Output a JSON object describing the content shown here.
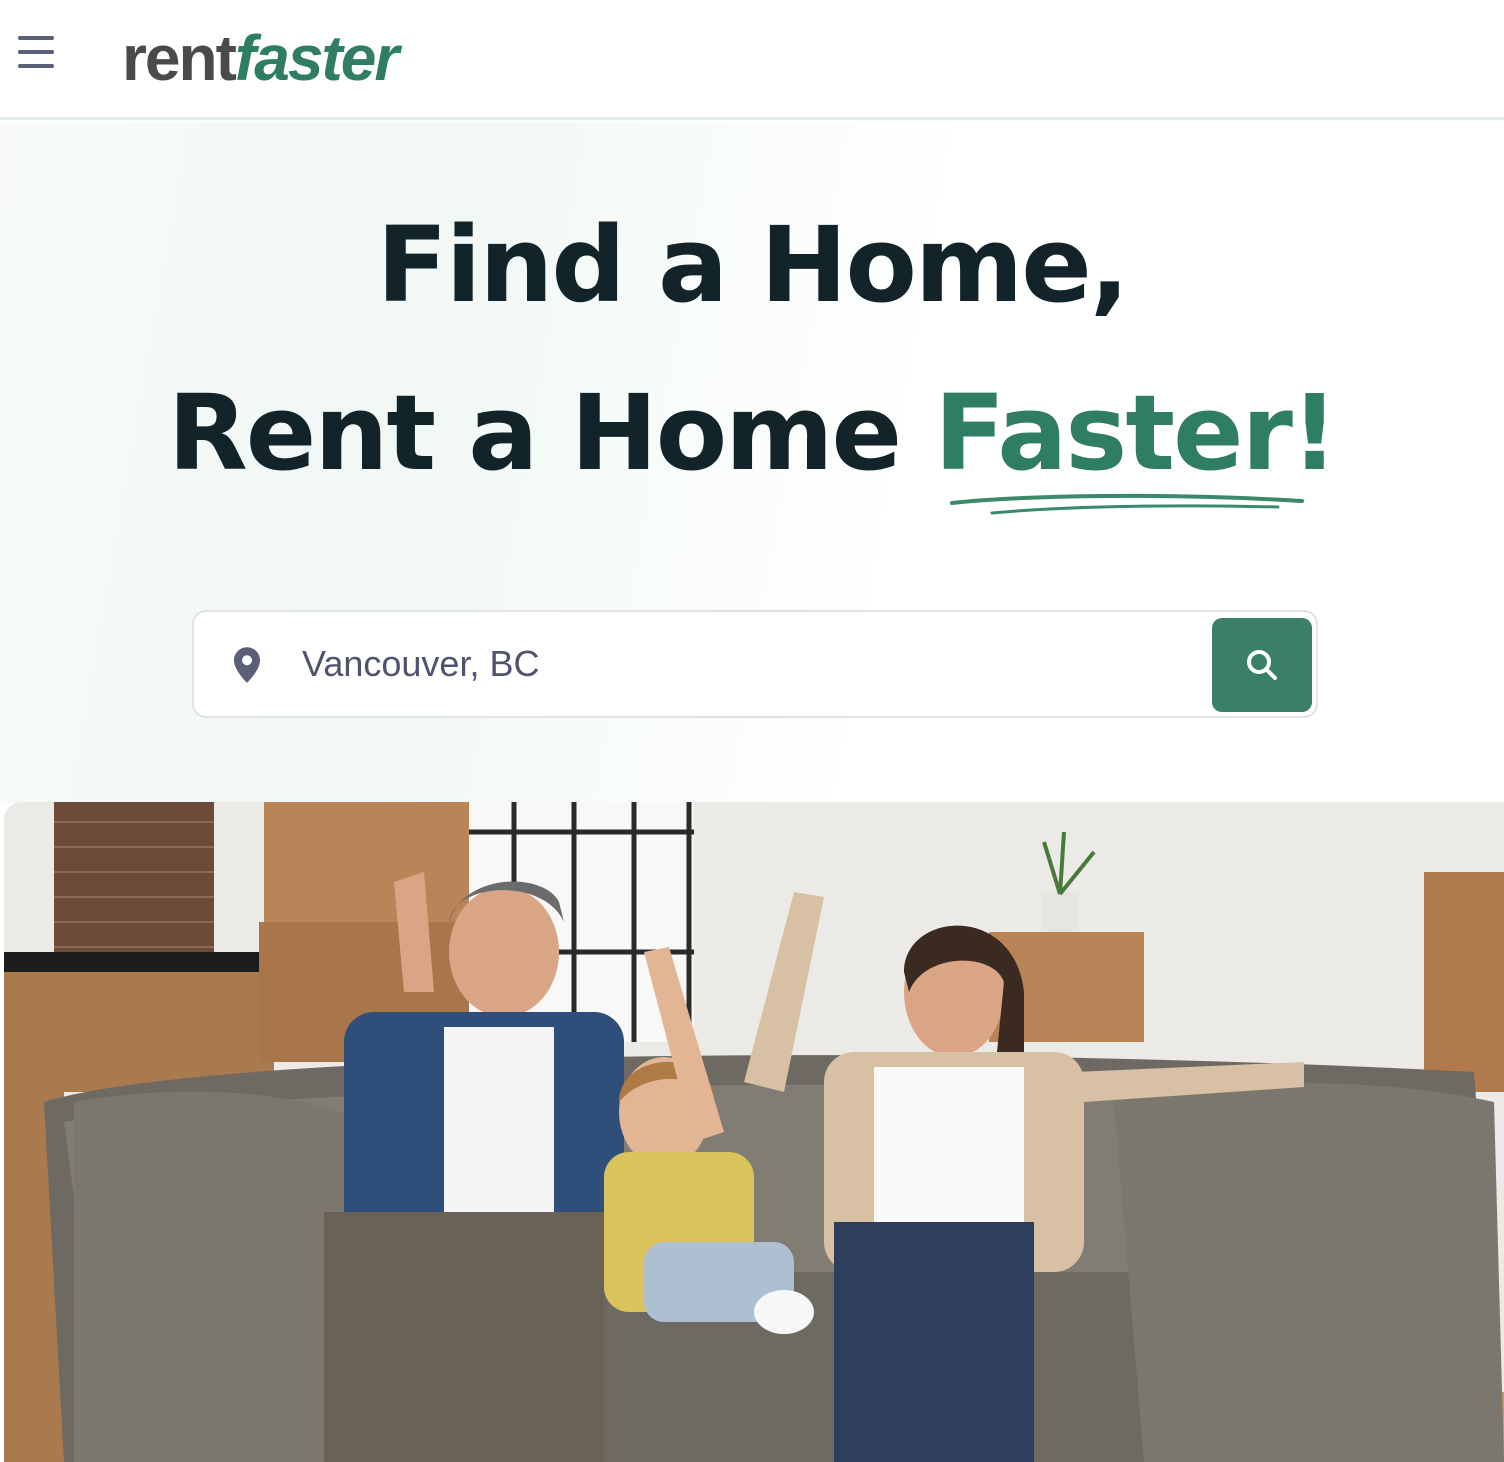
{
  "header": {
    "logo_rent": "rent",
    "logo_faster": "faster",
    "menu_icon": "hamburger-menu-icon"
  },
  "hero": {
    "line1": "Find a Home,",
    "line2_prefix": "Rent a Home ",
    "line2_accent": "Faster!",
    "accent_color": "#2f7e62",
    "text_color": "#13232a"
  },
  "search": {
    "value": "Vancouver, BC",
    "location_icon": "map-pin-icon",
    "button_icon": "search-icon",
    "button_color": "#3a8068"
  },
  "photo": {
    "icon": "hero-family-photo"
  }
}
